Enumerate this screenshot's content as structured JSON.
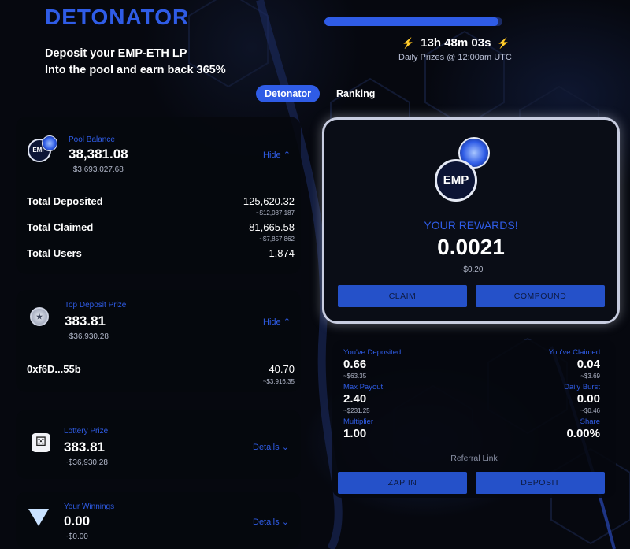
{
  "header": {
    "logo": "DETONATOR",
    "tagline_line1": "Deposit your EMP-ETH LP",
    "tagline_line2": "Into the pool and earn back 365%",
    "timer": "13h 48m 03s",
    "timer_sub": "Daily Prizes @ 12:00am UTC",
    "progress_fraction": 0.98
  },
  "tabs": [
    {
      "label": "Detonator",
      "active": true
    },
    {
      "label": "Ranking",
      "active": false
    }
  ],
  "pool": {
    "label": "Pool Balance",
    "value": "38,381.08",
    "usd": "~$3,693,027.68",
    "toggle": "Hide",
    "rows": [
      {
        "label": "Total Deposited",
        "value": "125,620.32",
        "sub": "~$12,087,187"
      },
      {
        "label": "Total Claimed",
        "value": "81,665.58",
        "sub": "~$7,857,862"
      },
      {
        "label": "Total Users",
        "value": "1,874",
        "sub": ""
      }
    ]
  },
  "top_deposit": {
    "label": "Top Deposit Prize",
    "value": "383.81",
    "usd": "~$36,930.28",
    "toggle": "Hide",
    "address": "0xf6D...55b",
    "address_value": "40.70",
    "address_usd": "~$3,916.35"
  },
  "lottery": {
    "label": "Lottery Prize",
    "value": "383.81",
    "usd": "~$36,930.28",
    "toggle": "Details"
  },
  "winnings": {
    "label": "Your Winnings",
    "value": "0.00",
    "usd": "~$0.00",
    "toggle": "Details"
  },
  "rewards": {
    "token_text": "EMP",
    "title": "YOUR REWARDS!",
    "value": "0.0021",
    "usd": "~$0.20",
    "claim_label": "CLAIM",
    "compound_label": "COMPOUND"
  },
  "user_stats": {
    "deposited_label": "You've Deposited",
    "deposited_value": "0.66",
    "deposited_usd": "~$63.35",
    "claimed_label": "You've Claimed",
    "claimed_value": "0.04",
    "claimed_usd": "~$3.69",
    "max_payout_label": "Max Payout",
    "max_payout_value": "2.40",
    "max_payout_usd": "~$231.25",
    "daily_burst_label": "Daily Burst",
    "daily_burst_value": "0.00",
    "daily_burst_usd": "~$0.46",
    "multiplier_label": "Multiplier",
    "multiplier_value": "1.00",
    "share_label": "Share",
    "share_value": "0.00%",
    "referral_label": "Referral Link",
    "zap_label": "ZAP IN",
    "deposit_label": "DEPOSIT"
  },
  "colors": {
    "accent": "#2f5ce6",
    "button": "#2551c9",
    "background": "#06080f"
  }
}
